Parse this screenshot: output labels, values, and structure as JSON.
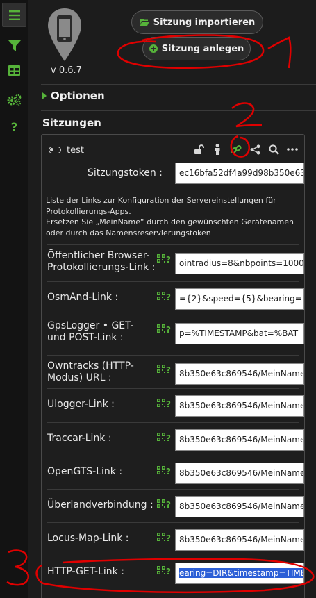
{
  "iconbar": {
    "items": [
      {
        "icon": "menu-icon"
      },
      {
        "icon": "filter-icon"
      },
      {
        "icon": "table-icon"
      },
      {
        "icon": "gears-icon"
      },
      {
        "icon": "help-icon",
        "label": "?"
      }
    ]
  },
  "header": {
    "version": "v 0.6.7",
    "import_label": "Sitzung importieren",
    "create_label": "Sitzung anlegen"
  },
  "options_label": "Optionen",
  "sessions_title": "Sitzungen",
  "session": {
    "name": "test",
    "token_label": "Sitzungstoken :",
    "token_value": "ec16bfa52df4a99d98b350e63",
    "info_lines": [
      "Liste der Links zur Konfiguration der Servereinstellungen für",
      "Protokollierungs-Apps.",
      "Ersetzen Sie „MeinName“ durch den gewünschten Gerätenamen",
      "oder durch das Namensreservierungstoken"
    ],
    "links": [
      {
        "label1": "Öffentlicher Browser-",
        "label2": "Protokollierungs-Link :",
        "value": "ointradius=8&nbpoints=1000"
      },
      {
        "label1": "OsmAnd-Link :",
        "label2": "",
        "value": "={2}&speed={5}&bearing={6}"
      },
      {
        "label1": "GpsLogger • GET-",
        "label2": "und POST-Link :",
        "value": "p=%TIMESTAMP&bat=%BAT"
      },
      {
        "label1": "Owntracks (HTTP-",
        "label2": "Modus) URL :",
        "value": "8b350e63c869546/MeinName"
      },
      {
        "label1": "Ulogger-Link :",
        "label2": "",
        "value": "8b350e63c869546/MeinName"
      },
      {
        "label1": "Traccar-Link :",
        "label2": "",
        "value": "8b350e63c869546/MeinName"
      },
      {
        "label1": "OpenGTS-Link :",
        "label2": "",
        "value": "8b350e63c869546/MeinName"
      },
      {
        "label1": "Überlandverbindung :",
        "label2": "",
        "value": "8b350e63c869546/MeinName"
      },
      {
        "label1": "Locus-Map-Link :",
        "label2": "",
        "value": "8b350e63c869546/MeinName"
      },
      {
        "label1": "HTTP-GET-Link :",
        "label2": "",
        "value": "earing=DIR&timestamp=TIME"
      }
    ]
  },
  "annotations": [
    "1",
    "2",
    "3"
  ],
  "colors": {
    "accent": "#56b33a",
    "annotation": "#e00000",
    "selection": "#2c5fd6"
  }
}
